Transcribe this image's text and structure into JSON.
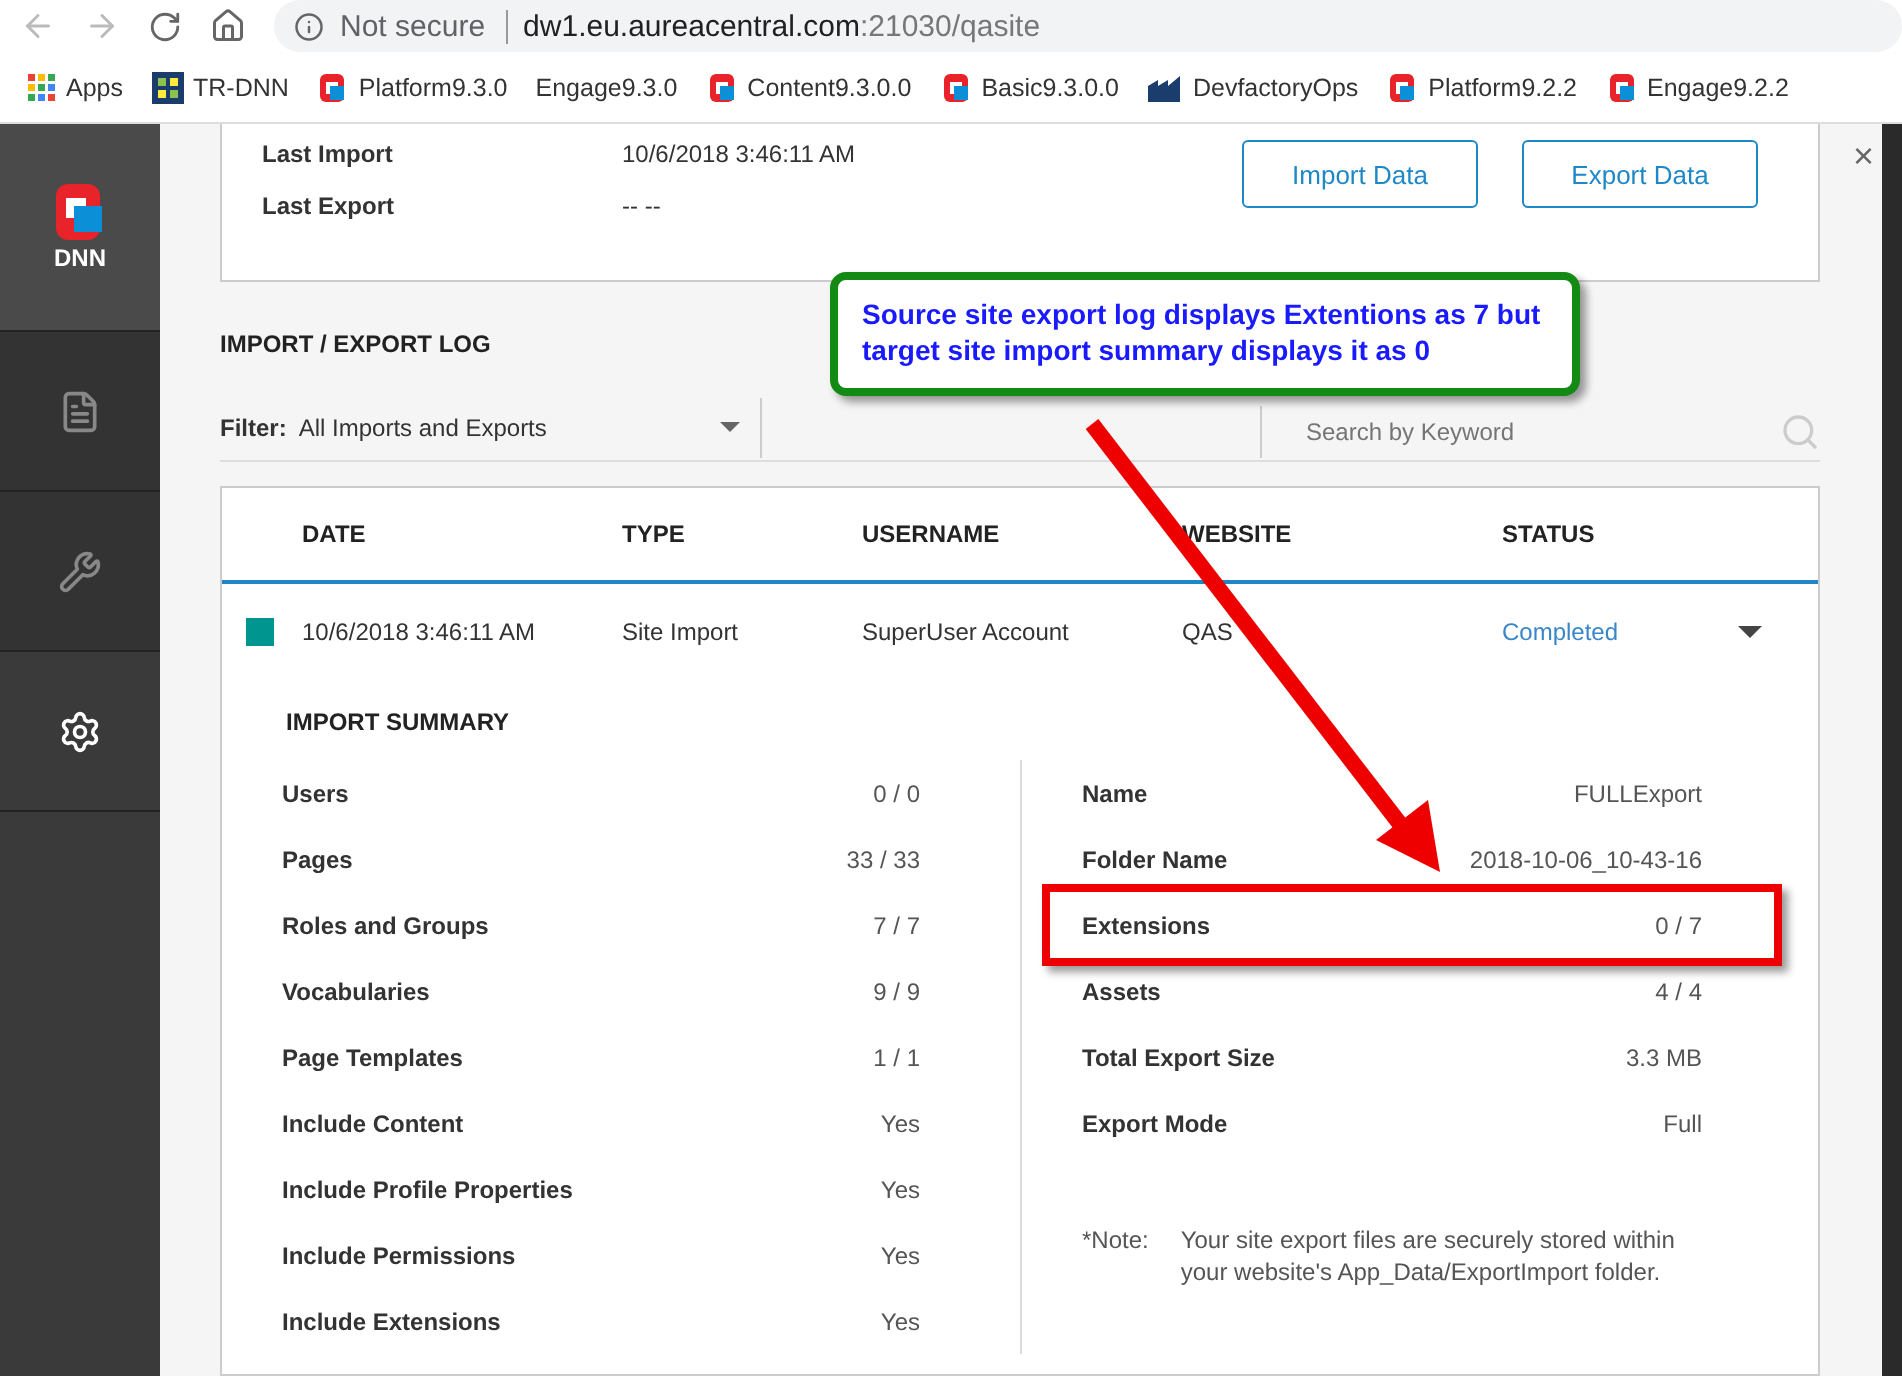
{
  "browser": {
    "url_security": "Not secure",
    "url_host": "dw1.eu.aureacentral.com",
    "url_path": ":21030/qasite"
  },
  "bookmarks": [
    {
      "label": "Apps",
      "kind": "apps"
    },
    {
      "label": "TR-DNN",
      "kind": "grid"
    },
    {
      "label": "Platform9.3.0",
      "kind": "dnn"
    },
    {
      "label": "Engage9.3.0",
      "kind": "none"
    },
    {
      "label": "Content9.3.0.0",
      "kind": "dnn"
    },
    {
      "label": "Basic9.3.0.0",
      "kind": "dnn"
    },
    {
      "label": "DevfactoryOps",
      "kind": "building"
    },
    {
      "label": "Platform9.2.2",
      "kind": "dnn"
    },
    {
      "label": "Engage9.2.2",
      "kind": "dnn"
    }
  ],
  "sidebar": {
    "logo": "DNN",
    "items": [
      {
        "kind": "pages",
        "selected": false
      },
      {
        "kind": "tools",
        "selected": false
      },
      {
        "kind": "settings",
        "selected": true
      }
    ]
  },
  "summary": [
    {
      "label": "Last Import",
      "value": "10/6/2018 3:46:11 AM"
    },
    {
      "label": "Last Export",
      "value": "-- --"
    }
  ],
  "buttons": [
    "Import Data",
    "Export Data"
  ],
  "close": "×",
  "log": {
    "title": "IMPORT / EXPORT LOG",
    "filter_label": "Filter:",
    "filter_value": "All Imports and Exports",
    "search_placeholder": "Search by Keyword"
  },
  "table": {
    "columns": [
      "DATE",
      "TYPE",
      "USERNAME",
      "WEBSITE",
      "STATUS"
    ],
    "rows": [
      {
        "color": "#00958f",
        "date": "10/6/2018 3:46:11 AM",
        "type": "Site Import",
        "username": "SuperUser Account",
        "website": "QAS",
        "status": "Completed",
        "expanded": true
      }
    ]
  },
  "import_summary": {
    "title": "IMPORT SUMMARY",
    "left": [
      {
        "label": "Users",
        "value": "0 / 0"
      },
      {
        "label": "Pages",
        "value": "33 / 33"
      },
      {
        "label": "Roles and Groups",
        "value": "7 / 7"
      },
      {
        "label": "Vocabularies",
        "value": "9 / 9"
      },
      {
        "label": "Page Templates",
        "value": "1 / 1"
      },
      {
        "label": "Include Content",
        "value": "Yes"
      },
      {
        "label": "Include Profile Properties",
        "value": "Yes"
      },
      {
        "label": "Include Permissions",
        "value": "Yes"
      },
      {
        "label": "Include Extensions",
        "value": "Yes"
      }
    ],
    "right": [
      {
        "label": "Name",
        "value": "FULLExport",
        "highlighted": false
      },
      {
        "label": "Folder Name",
        "value": "2018-10-06_10-43-16",
        "highlighted": false
      },
      {
        "label": "Extensions",
        "value": "0 / 7",
        "highlighted": true
      },
      {
        "label": "Assets",
        "value": "4 / 4",
        "highlighted": false
      },
      {
        "label": "Total Export Size",
        "value": "3.3 MB",
        "highlighted": false
      },
      {
        "label": "Export Mode",
        "value": "Full",
        "highlighted": false
      }
    ],
    "note_label": "*Note:",
    "note": "Your site export files are securely stored within your website's App_Data/ExportImport folder."
  },
  "annotation": {
    "text": "Source site export log displays Extentions as 7 but target site import summary displays it as 0"
  }
}
